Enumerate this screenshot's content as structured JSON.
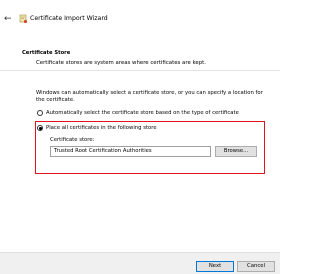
{
  "titlebar": {
    "back_icon": "back-arrow-icon",
    "wizard_icon": "certificate-wizard-icon",
    "title": "Certificate Import Wizard"
  },
  "header": {
    "title": "Certificate Store",
    "subtitle": "Certificate stores are system areas where certificates are kept."
  },
  "main": {
    "description": "Windows can automatically select a certificate store, or you can specify a location for the certificate.",
    "options": [
      {
        "label": "Automatically select the certificate store based on the type of certificate",
        "selected": false
      },
      {
        "label": "Place all certificates in the following store",
        "selected": true
      }
    ],
    "store_label": "Certificate store:",
    "store_value": "Trusted Root Certification Authorities",
    "browse_label": "Browse..."
  },
  "footer": {
    "next_label": "Next",
    "cancel_label": "Cancel"
  },
  "colors": {
    "highlight": "#e0141e",
    "accent": "#0078d7"
  }
}
